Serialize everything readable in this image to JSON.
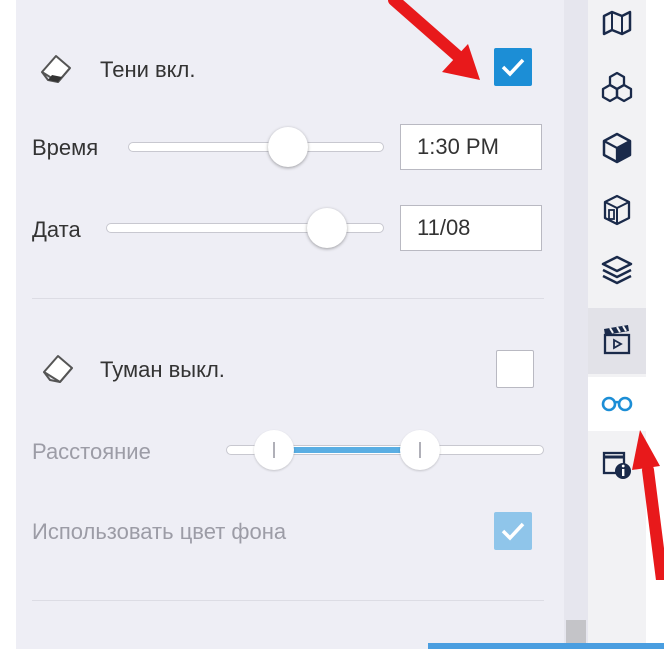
{
  "shadows": {
    "label": "Тени вкл.",
    "enabled": true,
    "time": {
      "label": "Время",
      "value": "1:30 PM",
      "slider_fraction": 0.62
    },
    "date": {
      "label": "Дата",
      "value": "11/08",
      "slider_fraction": 0.81
    }
  },
  "fog": {
    "label": "Туман выкл.",
    "enabled": false,
    "distance": {
      "label": "Расстояние",
      "range_start_fraction": 0.15,
      "range_end_fraction": 0.61
    },
    "use_background_color": {
      "label": "Использовать цвет фона",
      "checked": true
    }
  },
  "sidebar": {
    "icons": [
      "map-icon",
      "boxes-icon",
      "cube-icon",
      "glass-cube-icon",
      "layers-icon",
      "clapperboard-icon",
      "glasses-icon",
      "info-icon"
    ],
    "active": "glasses-icon"
  },
  "colors": {
    "accent": "#1c8ed6",
    "annotation_arrow": "#e8191b"
  }
}
